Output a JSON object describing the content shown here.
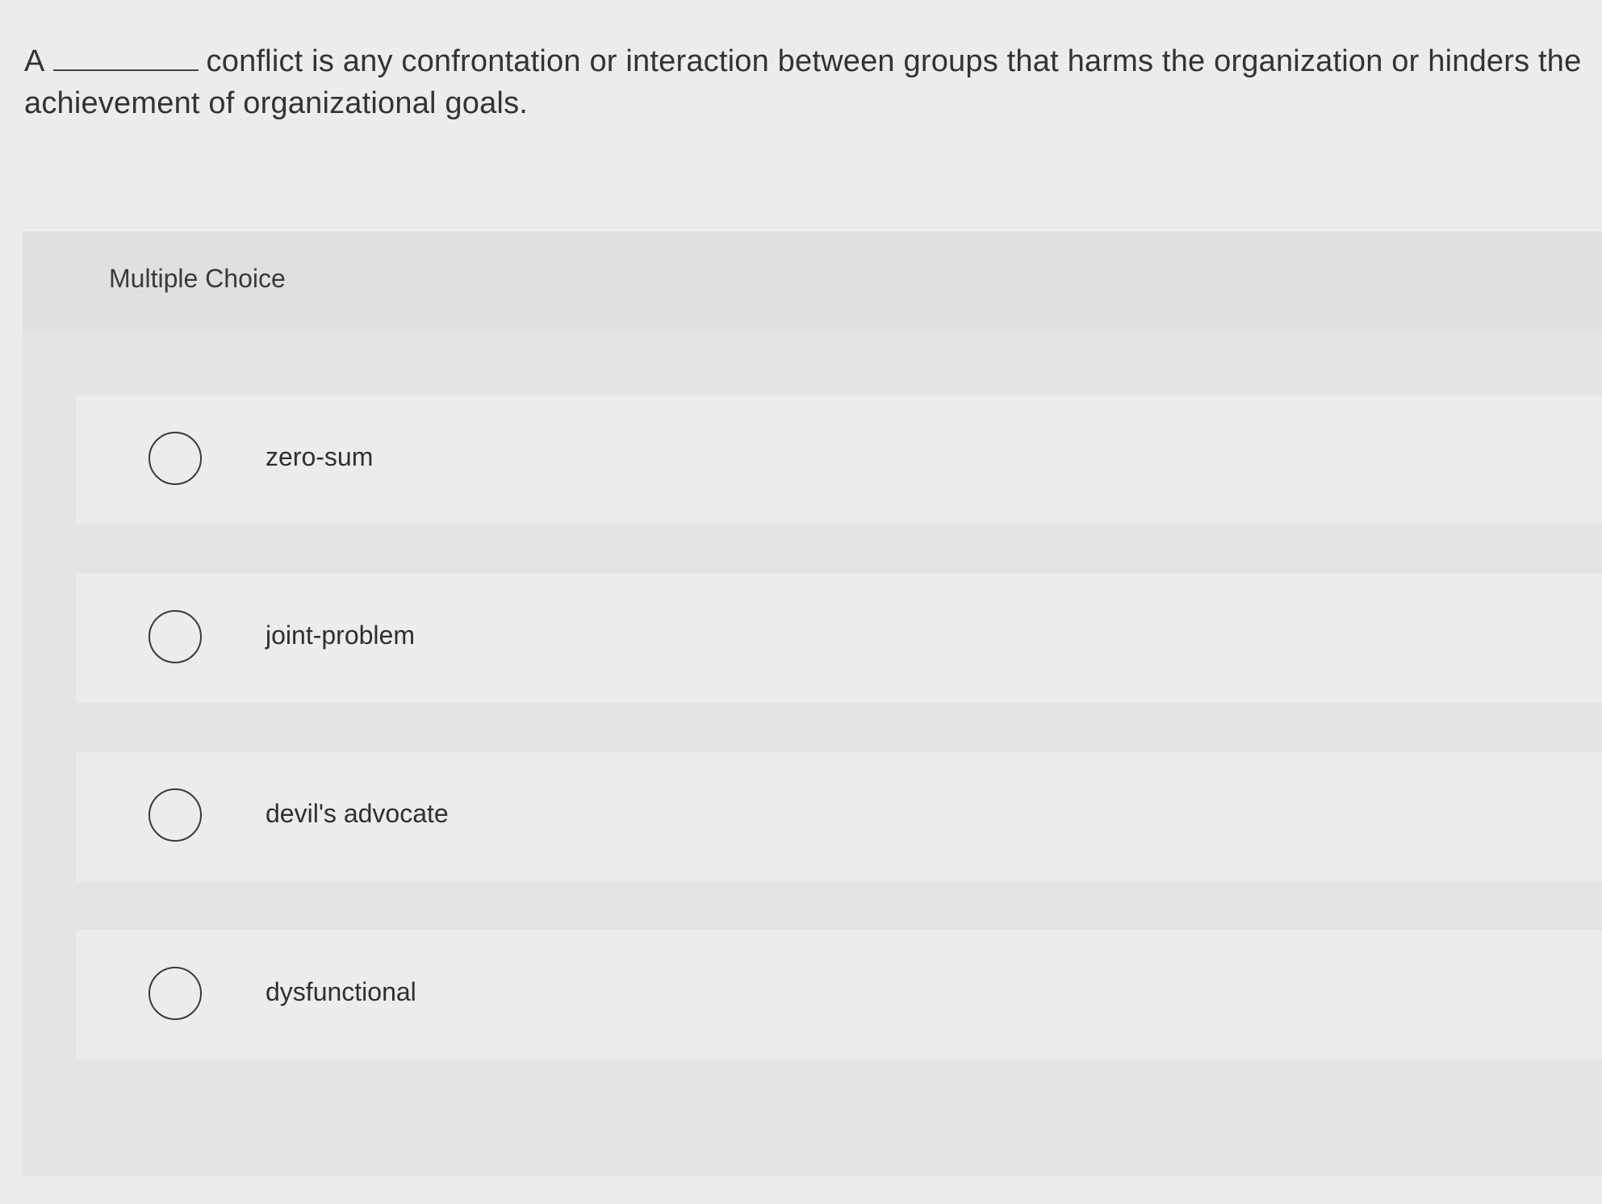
{
  "question": {
    "prefix": "A",
    "suffix": "conflict is any confrontation or interaction between groups that harms the organization or hinders the achievement of organizational goals."
  },
  "panel": {
    "title": "Multiple Choice"
  },
  "choices": [
    {
      "label": "zero-sum",
      "selected": false
    },
    {
      "label": "joint-problem",
      "selected": false
    },
    {
      "label": "devil's advocate",
      "selected": false
    },
    {
      "label": "dysfunctional",
      "selected": false
    }
  ]
}
